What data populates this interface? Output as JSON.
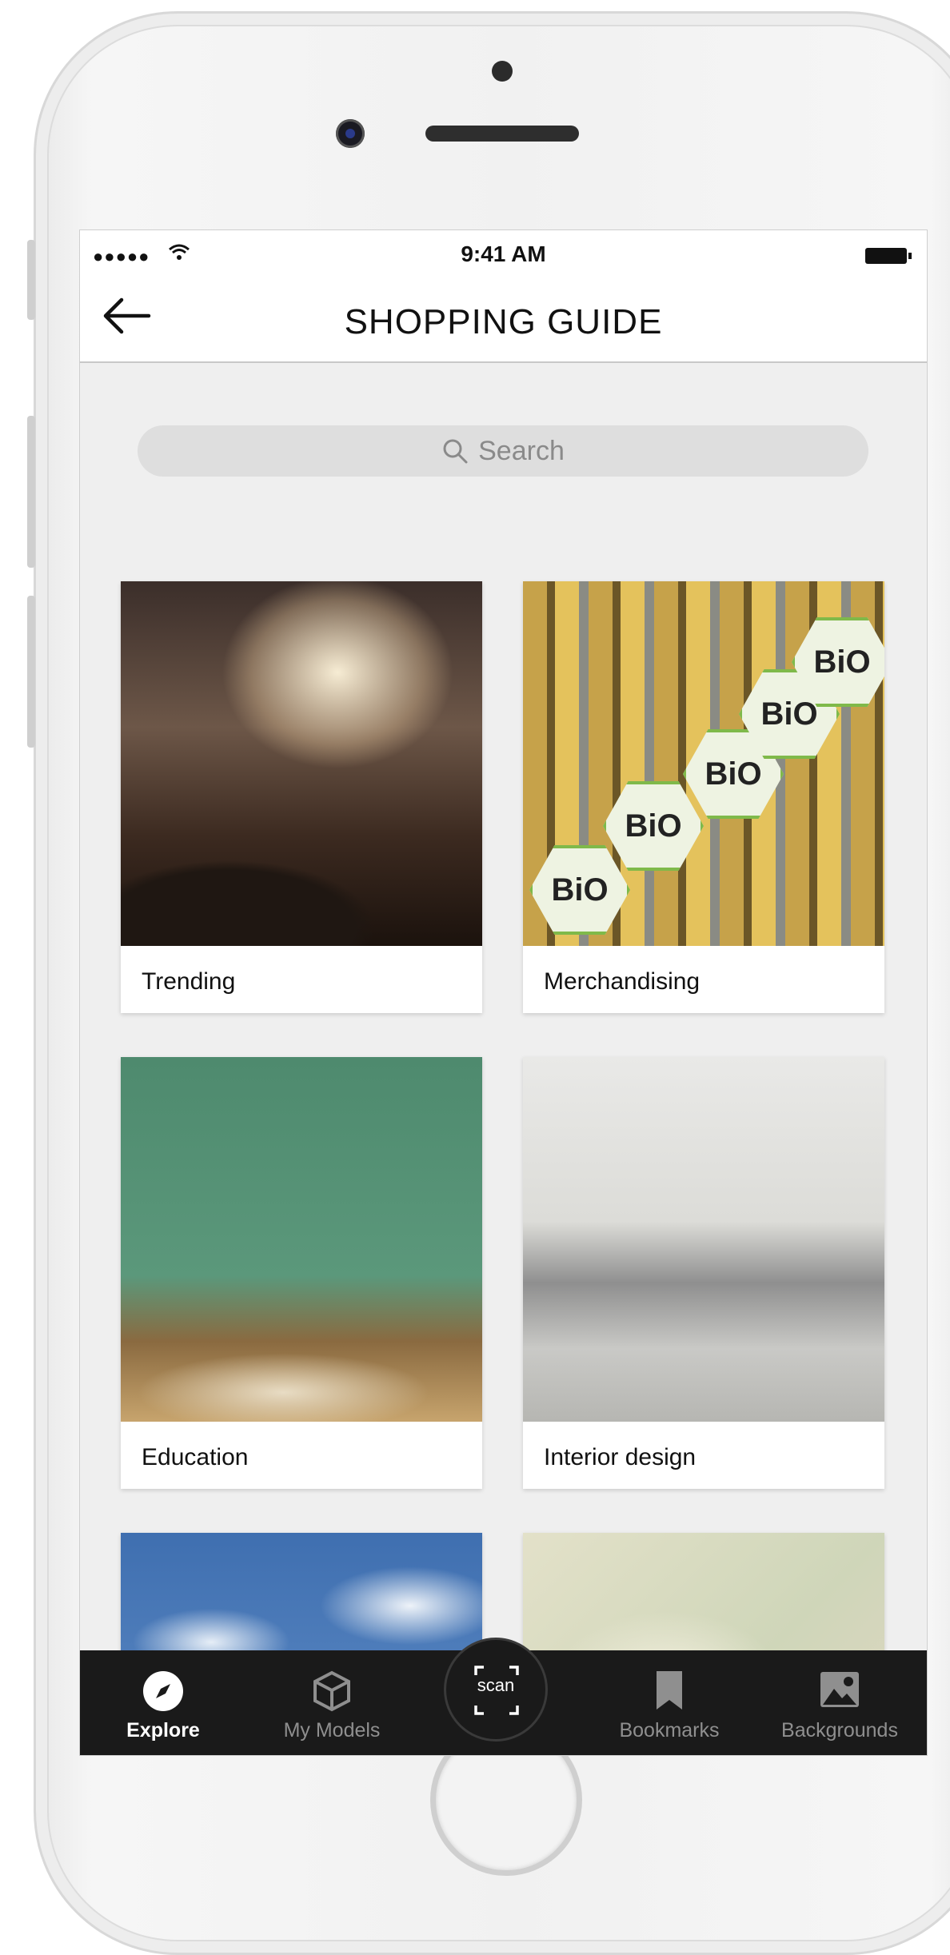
{
  "status": {
    "signal": "●●●●●",
    "time": "9:41 AM"
  },
  "header": {
    "back_icon": "arrow-left-icon",
    "title": "SHOPPING GUIDE"
  },
  "search": {
    "placeholder": "Search"
  },
  "categories": [
    {
      "label": "Trending"
    },
    {
      "label": "Merchandising"
    },
    {
      "label": "Education"
    },
    {
      "label": "Interior design"
    },
    {
      "label": ""
    },
    {
      "label": ""
    }
  ],
  "merch_badges": [
    "BiO",
    "BiO",
    "BiO",
    "BiO",
    "BiO"
  ],
  "tabs": [
    {
      "label": "Explore",
      "icon": "compass-icon",
      "active": true
    },
    {
      "label": "My Models",
      "icon": "cube-icon",
      "active": false
    },
    {
      "label": "scan",
      "icon": "scan-icon",
      "active": false
    },
    {
      "label": "Bookmarks",
      "icon": "bookmark-icon",
      "active": false
    },
    {
      "label": "Backgrounds",
      "icon": "image-icon",
      "active": false
    }
  ],
  "colors": {
    "tabbar": "#1a1a1a",
    "active_tab": "#ffffff",
    "inactive_tab": "#8f8f8f",
    "bio_green": "#7fb94a"
  }
}
